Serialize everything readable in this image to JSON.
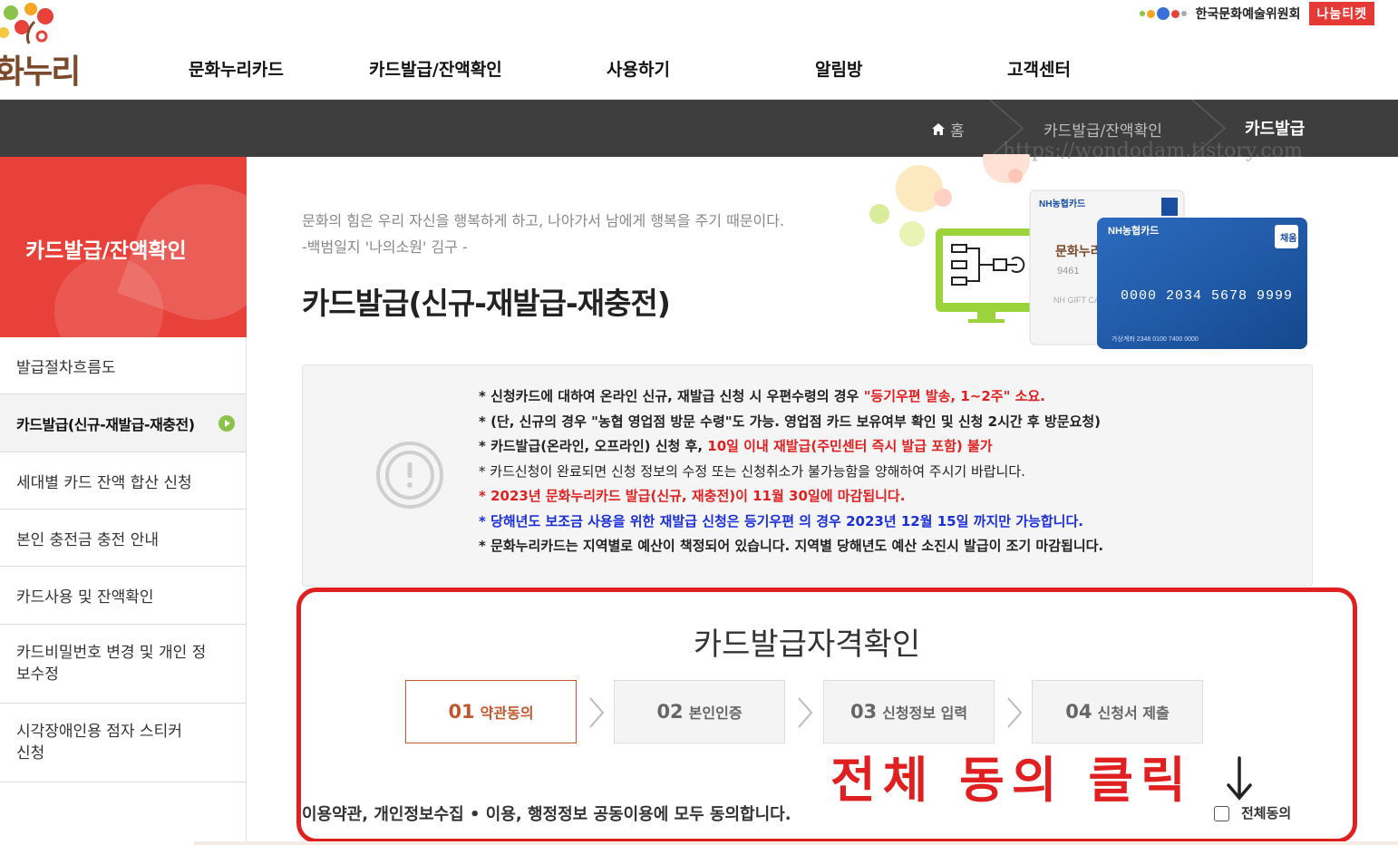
{
  "header": {
    "logo_text": "화누리",
    "nav": [
      "문화누리카드",
      "카드발급/잔액확인",
      "사용하기",
      "알림방",
      "고객센터"
    ],
    "partner_name": "한국문화예술위원회",
    "partner_badge": "나눔티켓"
  },
  "breadcrumb": {
    "home_icon": "home-icon",
    "home": "홈",
    "level1": "카드발급/잔액확인",
    "current": "카드발급"
  },
  "watermark": "https://wondodam.tistory.com",
  "sidebar": {
    "title": "카드발급/잔액확인",
    "items": [
      {
        "label": "발급절차흐름도",
        "active": false
      },
      {
        "label": "카드발급(신규-재발급-재충전)",
        "active": true
      },
      {
        "label": "세대별 카드 잔액 합산 신청",
        "active": false
      },
      {
        "label": "본인 충전금 충전 안내",
        "active": false
      },
      {
        "label": "카드사용 및 잔액확인",
        "active": false
      },
      {
        "label": "카드비밀번호 변경 및 개인 정보수정",
        "active": false
      },
      {
        "label": "시각장애인용 점자 스티커 신청",
        "active": false
      }
    ]
  },
  "main": {
    "quote": "문화의 힘은 우리 자신을 행복하게 하고, 나아가서 남에게 행복을 주기 때문이다.",
    "quote_source": "-백범일지 '나의소원' 김구 -",
    "title": "카드발급(신규-재발급-재충전)",
    "card_visual": {
      "card_brand": "NH농협카드",
      "card_number": "0000 2034 5678 9999",
      "card_badge": "채움",
      "card_logo": "문화누리",
      "card_sub": "NH GIFT CA",
      "card_account": "가상계좌 2348 0100 7400 0000",
      "card_digits": "9461"
    }
  },
  "notice": {
    "icon": "exclamation-circle-icon",
    "lines": [
      {
        "a": "* 신청카드에 대하여 온라인 신규, 재발급 신청 시 우편수령의 경우 ",
        "b": "\"등기우편 발송, 1~2주\" 소요."
      },
      {
        "a": "* (단, 신규의 경우 \"농협 영업점 방문 수령\"도 가능. 영업점 카드 보유여부 확인 및 신청 2시간 후 방문요청)",
        "b": ""
      },
      {
        "a": "* 카드발급(온라인, 오프라인) 신청 후, ",
        "b": "10일 이내 재발급(주민센터 즉시 발급 포함) 불가"
      },
      {
        "a": "* 카드신청이 완료되면 신청 정보의 수정 또는 신청취소가 불가능함을 양해하여 주시기 바랍니다.",
        "b": ""
      },
      {
        "a": "* ",
        "b": "2023년 문화누리카드 발급(신규, 재충전)이 11월 30일에 마감됩니다."
      },
      {
        "a": "* ",
        "b": "당해년도 보조금 사용을 위한 재발급 신청은 등기우편 의 경우 2023년 12월 15일 까지만 가능합니다."
      },
      {
        "a": "* 문화누리카드는 지역별로 예산이 책정되어 있습니다. 지역별 당해년도 예산 소진시 발급이 조기 마감됩니다.",
        "b": ""
      }
    ]
  },
  "certification": {
    "title": "카드발급자격확인",
    "steps": [
      {
        "num": "01",
        "label": "약관동의",
        "active": true
      },
      {
        "num": "02",
        "label": "본인인증",
        "active": false
      },
      {
        "num": "03",
        "label": "신청정보 입력",
        "active": false
      },
      {
        "num": "04",
        "label": "신청서 제출",
        "active": false
      }
    ]
  },
  "annotation": {
    "text": "전체 동의 클릭",
    "arrow": "down-arrow-icon"
  },
  "agreement": {
    "text": "이용약관, 개인정보수집 • 이용, 행정정보 공동이용에 모두 동의합니다.",
    "checkbox_label": "전체동의",
    "checked": false
  },
  "colors": {
    "brand_red": "#e8413a",
    "annotation_red": "#e02020",
    "active_step": "#c0582e",
    "notice_blue": "#1a2fd8",
    "crumb_bar": "#3e3e3e",
    "active_arrow": "#8bc34a"
  }
}
